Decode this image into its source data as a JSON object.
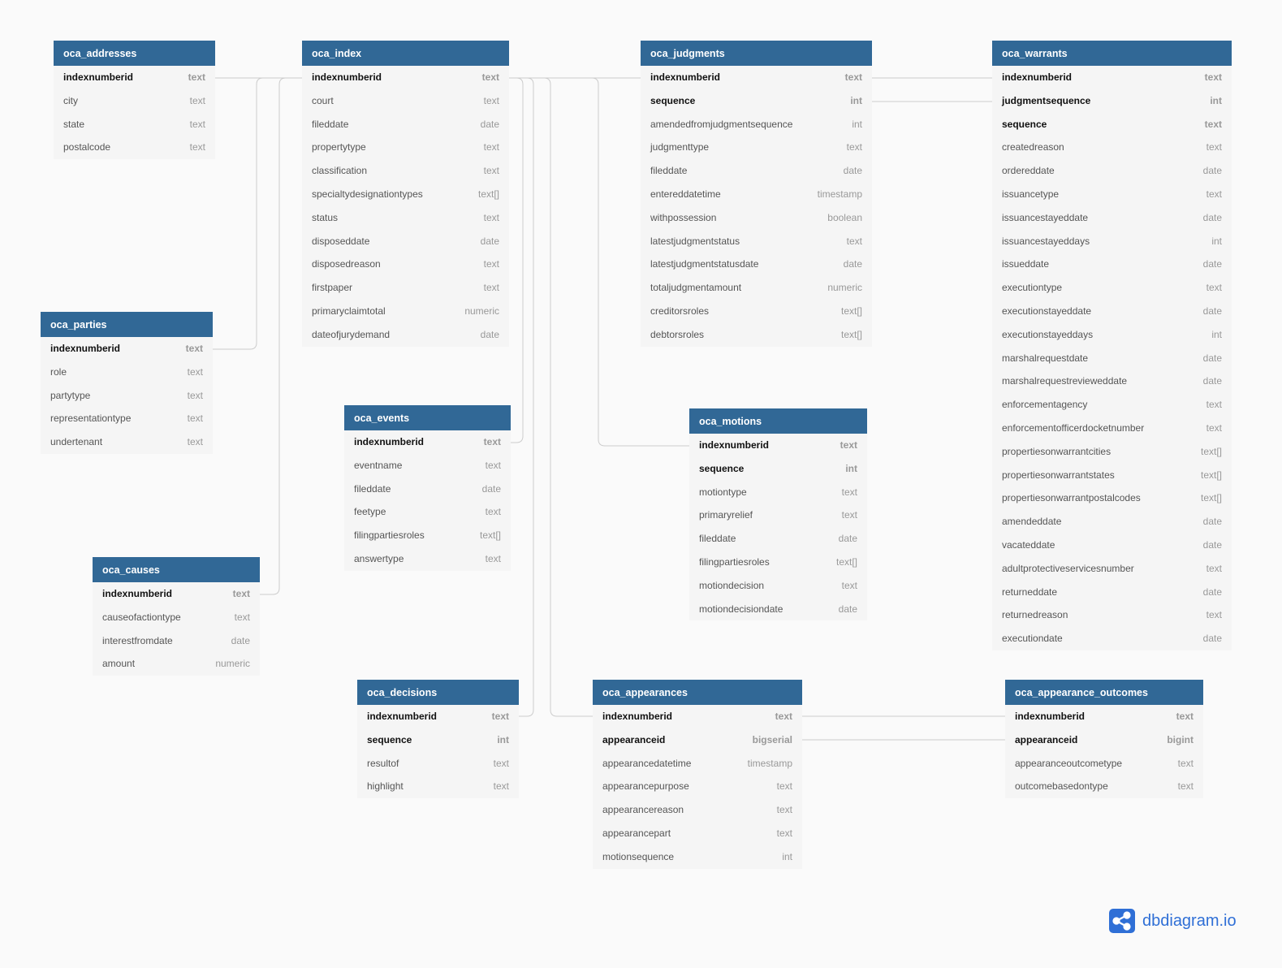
{
  "colors": {
    "header": "#316896",
    "line": "#cccccc",
    "logo": "#2f6fd6"
  },
  "logo": {
    "text": "dbdiagram.io",
    "icon": "share-nodes-icon"
  },
  "tables": [
    {
      "name": "oca_addresses",
      "columns": [
        {
          "name": "indexnumberid",
          "type": "text",
          "key": true
        },
        {
          "name": "city",
          "type": "text"
        },
        {
          "name": "state",
          "type": "text"
        },
        {
          "name": "postalcode",
          "type": "text"
        }
      ]
    },
    {
      "name": "oca_index",
      "columns": [
        {
          "name": "indexnumberid",
          "type": "text",
          "key": true
        },
        {
          "name": "court",
          "type": "text"
        },
        {
          "name": "fileddate",
          "type": "date"
        },
        {
          "name": "propertytype",
          "type": "text"
        },
        {
          "name": "classification",
          "type": "text"
        },
        {
          "name": "specialtydesignationtypes",
          "type": "text[]"
        },
        {
          "name": "status",
          "type": "text"
        },
        {
          "name": "disposeddate",
          "type": "date"
        },
        {
          "name": "disposedreason",
          "type": "text"
        },
        {
          "name": "firstpaper",
          "type": "text"
        },
        {
          "name": "primaryclaimtotal",
          "type": "numeric"
        },
        {
          "name": "dateofjurydemand",
          "type": "date"
        }
      ]
    },
    {
      "name": "oca_judgments",
      "columns": [
        {
          "name": "indexnumberid",
          "type": "text",
          "key": true
        },
        {
          "name": "sequence",
          "type": "int",
          "key": true
        },
        {
          "name": "amendedfromjudgmentsequence",
          "type": "int"
        },
        {
          "name": "judgmenttype",
          "type": "text"
        },
        {
          "name": "fileddate",
          "type": "date"
        },
        {
          "name": "entereddatetime",
          "type": "timestamp"
        },
        {
          "name": "withpossession",
          "type": "boolean"
        },
        {
          "name": "latestjudgmentstatus",
          "type": "text"
        },
        {
          "name": "latestjudgmentstatusdate",
          "type": "date"
        },
        {
          "name": "totaljudgmentamount",
          "type": "numeric"
        },
        {
          "name": "creditorsroles",
          "type": "text[]"
        },
        {
          "name": "debtorsroles",
          "type": "text[]"
        }
      ]
    },
    {
      "name": "oca_warrants",
      "columns": [
        {
          "name": "indexnumberid",
          "type": "text",
          "key": true
        },
        {
          "name": "judgmentsequence",
          "type": "int",
          "key": true
        },
        {
          "name": "sequence",
          "type": "text",
          "key": true
        },
        {
          "name": "createdreason",
          "type": "text"
        },
        {
          "name": "ordereddate",
          "type": "date"
        },
        {
          "name": "issuancetype",
          "type": "text"
        },
        {
          "name": "issuancestayeddate",
          "type": "date"
        },
        {
          "name": "issuancestayeddays",
          "type": "int"
        },
        {
          "name": "issueddate",
          "type": "date"
        },
        {
          "name": "executiontype",
          "type": "text"
        },
        {
          "name": "executionstayeddate",
          "type": "date"
        },
        {
          "name": "executionstayeddays",
          "type": "int"
        },
        {
          "name": "marshalrequestdate",
          "type": "date"
        },
        {
          "name": "marshalrequestrevieweddate",
          "type": "date"
        },
        {
          "name": "enforcementagency",
          "type": "text"
        },
        {
          "name": "enforcementofficerdocketnumber",
          "type": "text"
        },
        {
          "name": "propertiesonwarrantcities",
          "type": "text[]"
        },
        {
          "name": "propertiesonwarrantstates",
          "type": "text[]"
        },
        {
          "name": "propertiesonwarrantpostalcodes",
          "type": "text[]"
        },
        {
          "name": "amendeddate",
          "type": "date"
        },
        {
          "name": "vacateddate",
          "type": "date"
        },
        {
          "name": "adultprotectiveservicesnumber",
          "type": "text"
        },
        {
          "name": "returneddate",
          "type": "date"
        },
        {
          "name": "returnedreason",
          "type": "text"
        },
        {
          "name": "executiondate",
          "type": "date"
        }
      ]
    },
    {
      "name": "oca_parties",
      "columns": [
        {
          "name": "indexnumberid",
          "type": "text",
          "key": true
        },
        {
          "name": "role",
          "type": "text"
        },
        {
          "name": "partytype",
          "type": "text"
        },
        {
          "name": "representationtype",
          "type": "text"
        },
        {
          "name": "undertenant",
          "type": "text"
        }
      ]
    },
    {
      "name": "oca_events",
      "columns": [
        {
          "name": "indexnumberid",
          "type": "text",
          "key": true
        },
        {
          "name": "eventname",
          "type": "text"
        },
        {
          "name": "fileddate",
          "type": "date"
        },
        {
          "name": "feetype",
          "type": "text"
        },
        {
          "name": "filingpartiesroles",
          "type": "text[]"
        },
        {
          "name": "answertype",
          "type": "text"
        }
      ]
    },
    {
      "name": "oca_motions",
      "columns": [
        {
          "name": "indexnumberid",
          "type": "text",
          "key": true
        },
        {
          "name": "sequence",
          "type": "int",
          "key": true
        },
        {
          "name": "motiontype",
          "type": "text"
        },
        {
          "name": "primaryrelief",
          "type": "text"
        },
        {
          "name": "fileddate",
          "type": "date"
        },
        {
          "name": "filingpartiesroles",
          "type": "text[]"
        },
        {
          "name": "motiondecision",
          "type": "text"
        },
        {
          "name": "motiondecisiondate",
          "type": "date"
        }
      ]
    },
    {
      "name": "oca_causes",
      "columns": [
        {
          "name": "indexnumberid",
          "type": "text",
          "key": true
        },
        {
          "name": "causeofactiontype",
          "type": "text"
        },
        {
          "name": "interestfromdate",
          "type": "date"
        },
        {
          "name": "amount",
          "type": "numeric"
        }
      ]
    },
    {
      "name": "oca_decisions",
      "columns": [
        {
          "name": "indexnumberid",
          "type": "text",
          "key": true
        },
        {
          "name": "sequence",
          "type": "int",
          "key": true
        },
        {
          "name": "resultof",
          "type": "text"
        },
        {
          "name": "highlight",
          "type": "text"
        }
      ]
    },
    {
      "name": "oca_appearances",
      "columns": [
        {
          "name": "indexnumberid",
          "type": "text",
          "key": true
        },
        {
          "name": "appearanceid",
          "type": "bigserial",
          "key": true
        },
        {
          "name": "appearancedatetime",
          "type": "timestamp"
        },
        {
          "name": "appearancepurpose",
          "type": "text"
        },
        {
          "name": "appearancereason",
          "type": "text"
        },
        {
          "name": "appearancepart",
          "type": "text"
        },
        {
          "name": "motionsequence",
          "type": "int"
        }
      ]
    },
    {
      "name": "oca_appearance_outcomes",
      "columns": [
        {
          "name": "indexnumberid",
          "type": "text",
          "key": true
        },
        {
          "name": "appearanceid",
          "type": "bigint",
          "key": true
        },
        {
          "name": "appearanceoutcometype",
          "type": "text"
        },
        {
          "name": "outcomebasedontype",
          "type": "text"
        }
      ]
    }
  ],
  "relationships": [
    {
      "from": "oca_addresses.indexnumberid",
      "to": "oca_index.indexnumberid"
    },
    {
      "from": "oca_parties.indexnumberid",
      "to": "oca_index.indexnumberid"
    },
    {
      "from": "oca_causes.indexnumberid",
      "to": "oca_index.indexnumberid"
    },
    {
      "from": "oca_index.indexnumberid",
      "to": "oca_events.indexnumberid"
    },
    {
      "from": "oca_index.indexnumberid",
      "to": "oca_decisions.indexnumberid"
    },
    {
      "from": "oca_index.indexnumberid",
      "to": "oca_appearances.indexnumberid"
    },
    {
      "from": "oca_index.indexnumberid",
      "to": "oca_motions.indexnumberid"
    },
    {
      "from": "oca_index.indexnumberid",
      "to": "oca_judgments.indexnumberid"
    },
    {
      "from": "oca_judgments.indexnumberid",
      "to": "oca_warrants.indexnumberid"
    },
    {
      "from": "oca_judgments.sequence",
      "to": "oca_warrants.judgmentsequence"
    },
    {
      "from": "oca_appearances.indexnumberid",
      "to": "oca_appearance_outcomes.indexnumberid"
    },
    {
      "from": "oca_appearances.appearanceid",
      "to": "oca_appearance_outcomes.appearanceid"
    }
  ]
}
